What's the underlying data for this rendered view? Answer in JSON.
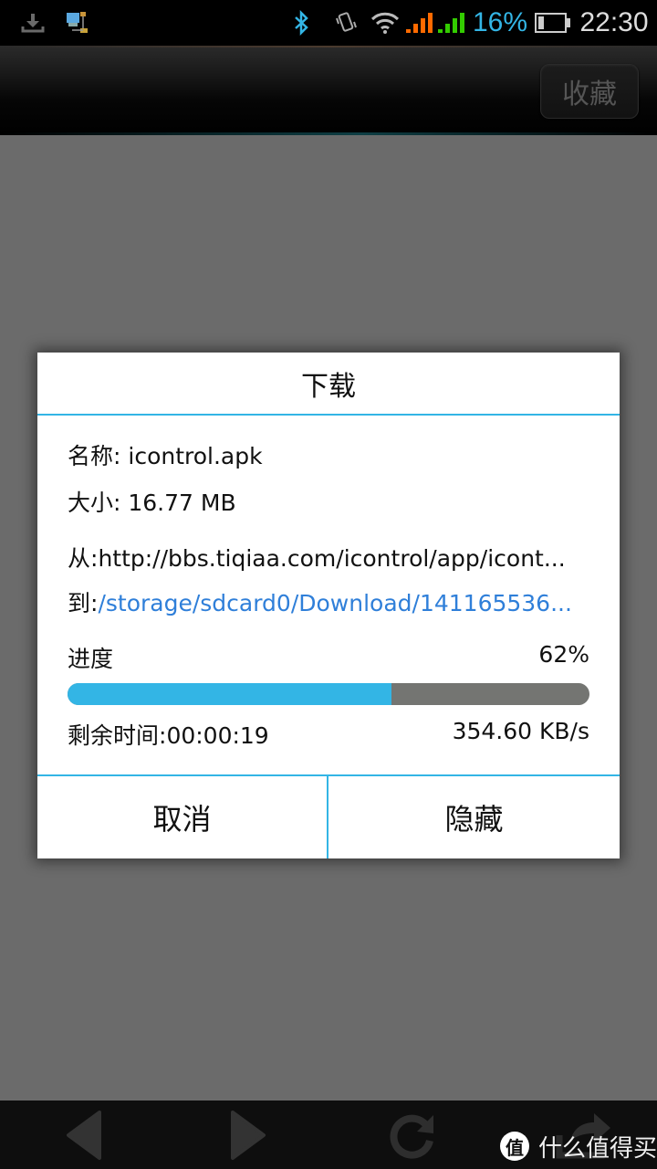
{
  "status_bar": {
    "icons": [
      "download-icon",
      "network-icon",
      "bluetooth-icon",
      "vibrate-icon",
      "wifi-icon",
      "signal-1-icon",
      "signal-2-icon",
      "battery-icon"
    ],
    "battery_percent": "16%",
    "time": "22:30",
    "colors": {
      "bluetooth": "#33b5e5",
      "signal_1": "#ff6a00",
      "signal_2": "#33cc00",
      "battery_text": "#33b5e5"
    }
  },
  "app_bar": {
    "favorite_label": "收藏"
  },
  "dialog": {
    "title": "下载",
    "name_label": "名称: ",
    "name_value": "icontrol.apk",
    "size_label": "大小: ",
    "size_value": "16.77 MB",
    "from_label": "从:",
    "from_value": "http://bbs.tiqiaa.com/icontrol/app/icont...",
    "to_label": "到:",
    "to_value": "/storage/sdcard0/Download/141165536...",
    "progress_label": "进度",
    "progress_text": "62%",
    "progress_value": 0.62,
    "remaining_label": "剩余时间:",
    "remaining_value": "00:00:19",
    "speed": "354.60 KB/s",
    "cancel_label": "取消",
    "hide_label": "隐藏",
    "accent_color": "#33b5e5"
  },
  "bottom_bar": {
    "icons": [
      "back-arrow-icon",
      "forward-arrow-icon",
      "refresh-icon",
      "share-icon"
    ]
  },
  "watermark": {
    "logo_char": "值",
    "text": "什么值得买"
  }
}
